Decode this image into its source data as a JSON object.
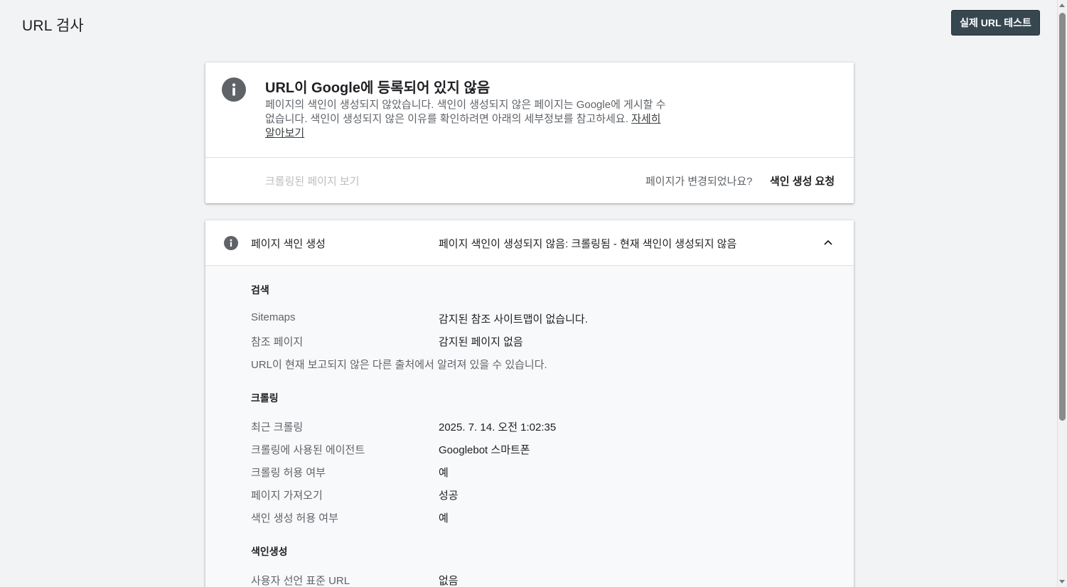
{
  "header": {
    "title": "URL 검사",
    "live_test_label": "실제 URL 테스트"
  },
  "status": {
    "title": "URL이 Google에 등록되어 있지 않음",
    "description": "페이지의 색인이 생성되지 않았습니다. 색인이 생성되지 않은 페이지는 Google에 게시할 수 없습니다. 색인이 생성되지 않은 이유를 확인하려면 아래의 세부정보를 참고하세요.",
    "learn_more": "자세히 알아보기",
    "crawled_page_link": "크롤링된 페이지 보기",
    "changed_question": "페이지가 변경되었나요?",
    "request_indexing": "색인 생성 요청"
  },
  "indexing_panel": {
    "label": "페이지 색인 생성",
    "value": "페이지 색인이 생성되지 않음: 크롤링됨 - 현재 색인이 생성되지 않음",
    "sections": {
      "search": {
        "heading": "검색",
        "sitemaps_label": "Sitemaps",
        "sitemaps_value": "감지된 참조 사이트맵이 없습니다.",
        "referring_label": "참조 페이지",
        "referring_value": "감지된 페이지 없음",
        "note": "URL이 현재 보고되지 않은 다른 출처에서 알려져 있을 수 있습니다."
      },
      "crawl": {
        "heading": "크롤링",
        "last_crawl_label": "최근 크롤링",
        "last_crawl_value": "2025. 7. 14. 오전 1:02:35",
        "agent_label": "크롤링에 사용된 에이전트",
        "agent_value": "Googlebot 스마트폰",
        "allowed_label": "크롤링 허용 여부",
        "allowed_value": "예",
        "fetch_label": "페이지 가져오기",
        "fetch_value": "성공",
        "index_allowed_label": "색인 생성 허용 여부",
        "index_allowed_value": "예"
      },
      "indexing": {
        "heading": "색인생성",
        "canonical_label": "사용자 선언 표준 URL",
        "canonical_value": "없음"
      }
    }
  },
  "colors": {
    "background": "#f1f3f4",
    "button": "#37474f",
    "icon": "#5f6368"
  }
}
